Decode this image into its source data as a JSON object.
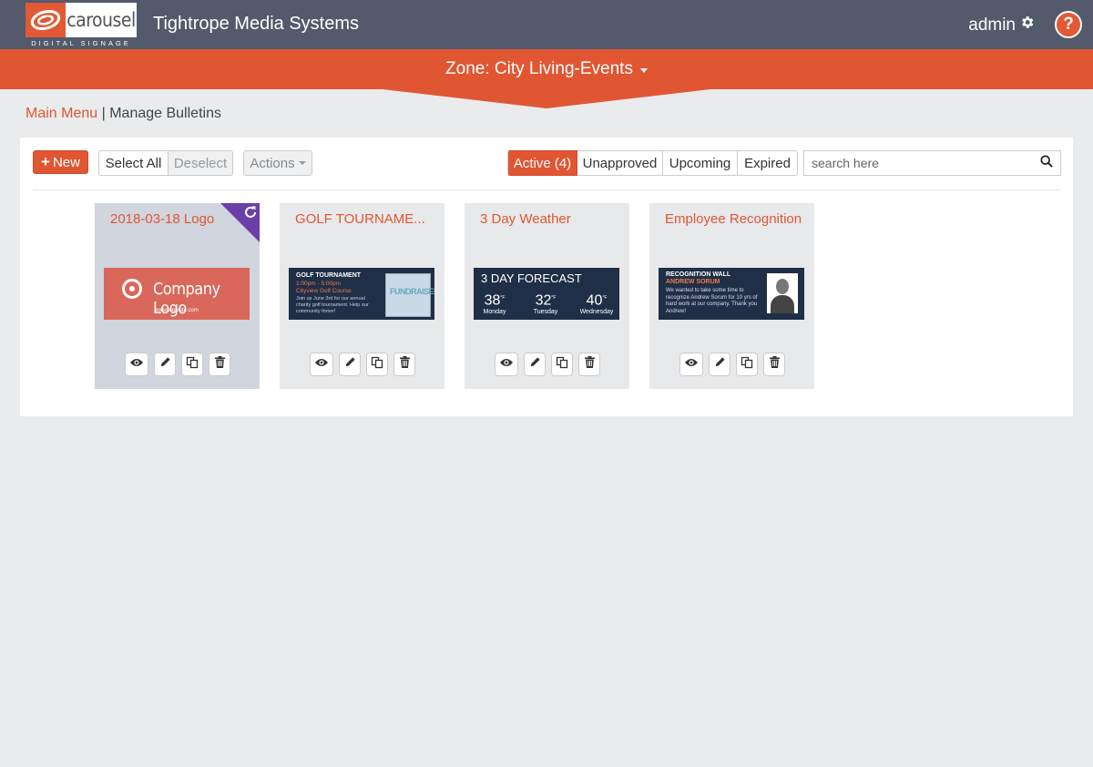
{
  "header": {
    "logo_word": "carousel",
    "logo_sub": "DIGITAL SIGNAGE",
    "company": "Tightrope Media Systems",
    "user": "admin",
    "help_label": "?"
  },
  "zone": {
    "title": "Zone: City Living-Events"
  },
  "breadcrumb": {
    "link": "Main Menu",
    "separator": "|",
    "current": "Manage Bulletins"
  },
  "toolbar": {
    "new_label": "New",
    "select_all": "Select All",
    "deselect": "Deselect",
    "actions": "Actions",
    "filters": [
      "Active (4)",
      "Unapproved",
      "Upcoming",
      "Expired"
    ],
    "active_filter": "Active (4)",
    "search_placeholder": "search here"
  },
  "bulletins": [
    {
      "title": "2018-03-18 Logo",
      "thumb": {
        "text": "Company Logo",
        "web": "www.website.com"
      }
    },
    {
      "title": "GOLF TOURNAME...",
      "thumb": {
        "heading": "GOLF TOURNAMENT",
        "time": "1:00pm - 5:00pm",
        "place": "Cityview Golf Course",
        "body": "Join us June 3rd for our annual charity golf tournament. Help our community thrive!",
        "heart": "FUNDRAISER"
      }
    },
    {
      "title": "3 Day Weather",
      "thumb": {
        "heading": "3 DAY FORECAST",
        "days": [
          {
            "temp": "38",
            "unit": "°F",
            "day": "Monday"
          },
          {
            "temp": "32",
            "unit": "°F",
            "day": "Tuesday"
          },
          {
            "temp": "40",
            "unit": "°F",
            "day": "Wednesday"
          }
        ]
      }
    },
    {
      "title": "Employee Recognition",
      "thumb": {
        "heading": "RECOGNITION WALL",
        "name": "ANDREW SORUM",
        "body": "We wanted to take some time to recognize Andrew Sorum for 10 yrs of hard work at our company. Thank you Andrew!"
      }
    }
  ],
  "colors": {
    "accent": "#e05633",
    "header": "#525a6b",
    "corner": "#6b3fa8",
    "selected_card": "#d0d5de"
  },
  "icons": [
    "gear-icon",
    "help-icon",
    "plus-icon",
    "caret-down-icon",
    "search-icon",
    "refresh-icon",
    "eye-icon",
    "pencil-icon",
    "copy-icon",
    "trash-icon"
  ]
}
